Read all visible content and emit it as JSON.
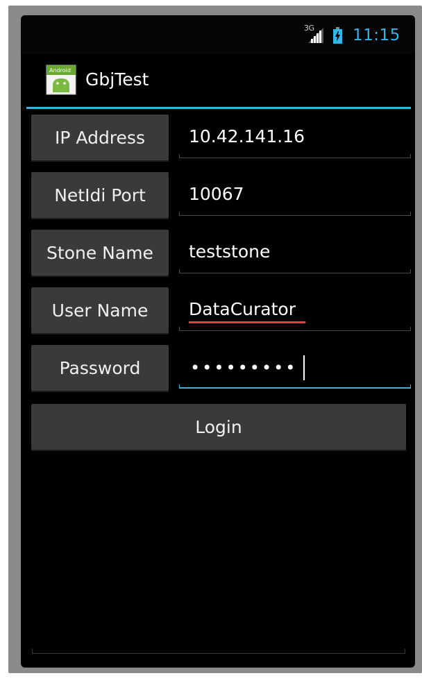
{
  "status_bar": {
    "network_label": "3G",
    "time": "11:15",
    "accent_color": "#33b5e5"
  },
  "action_bar": {
    "title": "GbjTest",
    "icon": "android-app-icon",
    "icon_text": "Android"
  },
  "form": {
    "ip_address": {
      "label": "IP Address",
      "value": "10.42.141.16"
    },
    "netldi_port": {
      "label": "NetIdi Port",
      "value": "10067"
    },
    "stone_name": {
      "label": "Stone Name",
      "value": "teststone"
    },
    "user_name": {
      "label": "User Name",
      "value": "DataCurator"
    },
    "password": {
      "label": "Password",
      "value": "•••••••••"
    }
  },
  "login_button": {
    "label": "Login"
  },
  "colors": {
    "background": "#000000",
    "button": "#3a3a3a",
    "focus": "#33b5e5",
    "spellcheck": "#e83e3e"
  }
}
